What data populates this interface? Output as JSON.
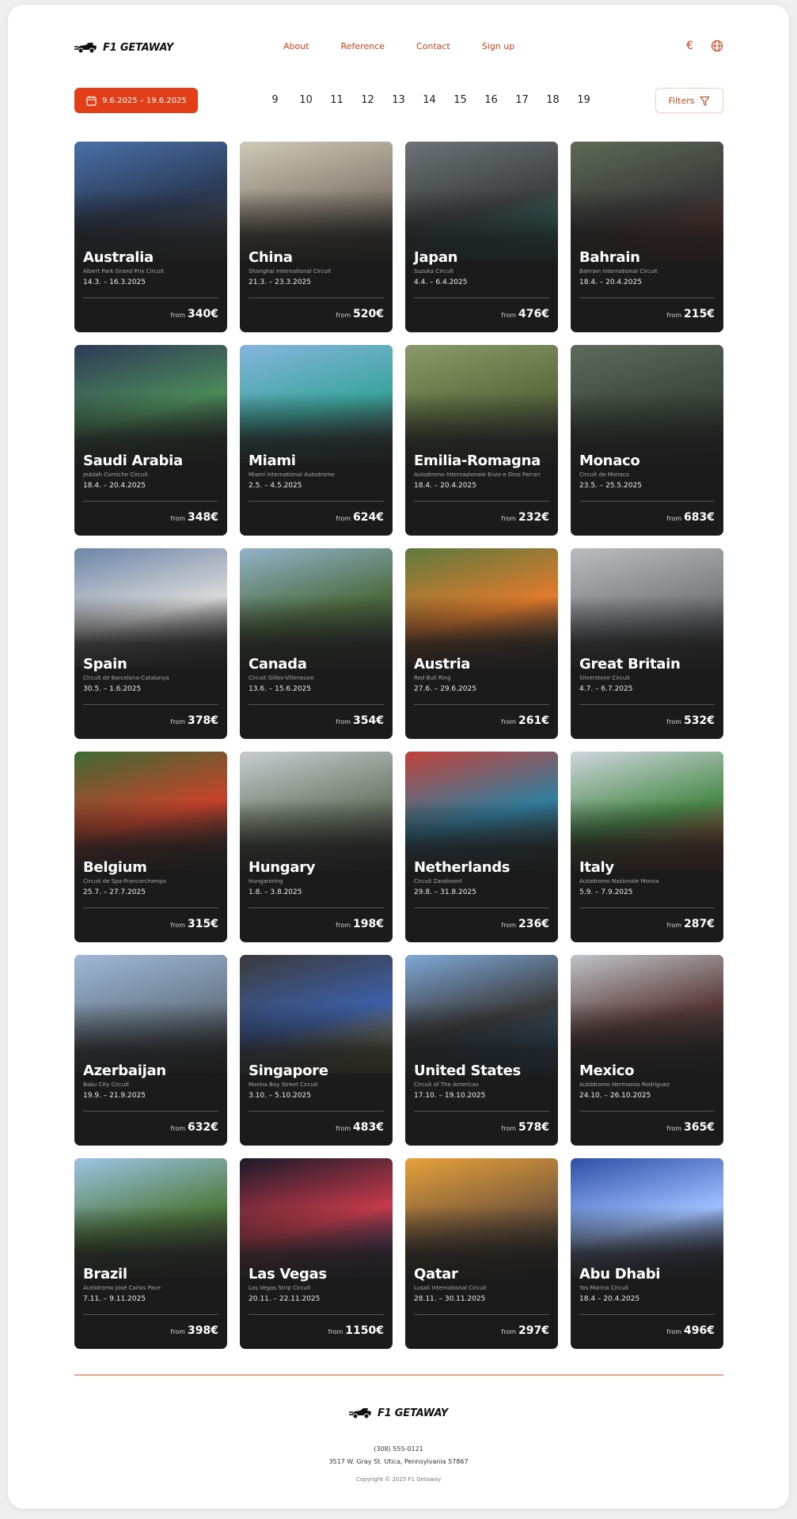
{
  "brand": {
    "name": "F1 GETAWAY",
    "accent_color": "#e23e17"
  },
  "nav": {
    "items": [
      "About",
      "Reference",
      "Contact",
      "Sign up"
    ]
  },
  "header_icons": {
    "currency": "euro-icon",
    "language": "globe-icon",
    "currency_symbol": "€"
  },
  "toolbar": {
    "date_range": "9.6.2025 – 19.6.2025",
    "days": [
      "9",
      "10",
      "11",
      "12",
      "13",
      "14",
      "15",
      "16",
      "17",
      "18",
      "19"
    ],
    "filters_label": "Filters"
  },
  "price_prefix": "from",
  "races": [
    {
      "country": "Australia",
      "circuit": "Albert Park Grand Prix Circuit",
      "dates": "14.3. – 16.3.2025",
      "price": "340€"
    },
    {
      "country": "China",
      "circuit": "Shanghai International Circuit",
      "dates": "21.3. – 23.3.2025",
      "price": "520€"
    },
    {
      "country": "Japan",
      "circuit": "Suzuka Circuit",
      "dates": "4.4. – 6.4.2025",
      "price": "476€"
    },
    {
      "country": "Bahrain",
      "circuit": "Bahrain International Circuit",
      "dates": "18.4. – 20.4.2025",
      "price": "215€"
    },
    {
      "country": "Saudi Arabia",
      "circuit": "Jeddah Corniche Circuit",
      "dates": "18.4. – 20.4.2025",
      "price": "348€"
    },
    {
      "country": "Miami",
      "circuit": "Miami International Autodrome",
      "dates": "2.5. – 4.5.2025",
      "price": "624€"
    },
    {
      "country": "Emilia-Romagna",
      "circuit": "Autodromo Internazionale Enzo e Dino Ferrari",
      "dates": "18.4. – 20.4.2025",
      "price": "232€"
    },
    {
      "country": "Monaco",
      "circuit": "Circuit de Monaco",
      "dates": "23.5. – 25.5.2025",
      "price": "683€"
    },
    {
      "country": "Spain",
      "circuit": "Circuit de Barcelona-Catalunya",
      "dates": "30.5. – 1.6.2025",
      "price": "378€"
    },
    {
      "country": "Canada",
      "circuit": "Circuit Gilles-Villeneuve",
      "dates": "13.6. – 15.6.2025",
      "price": "354€"
    },
    {
      "country": "Austria",
      "circuit": "Red Bull Ring",
      "dates": "27.6. – 29.6.2025",
      "price": "261€"
    },
    {
      "country": "Great Britain",
      "circuit": "Silverstone Circuit",
      "dates": "4.7. – 6.7.2025",
      "price": "532€"
    },
    {
      "country": "Belgium",
      "circuit": "Circuit de Spa-Francorchamps",
      "dates": "25.7. – 27.7.2025",
      "price": "315€"
    },
    {
      "country": "Hungary",
      "circuit": "Hungaroring",
      "dates": "1.8. – 3.8.2025",
      "price": "198€"
    },
    {
      "country": "Netherlands",
      "circuit": "Circuit Zandvoort",
      "dates": "29.8. – 31.8.2025",
      "price": "236€"
    },
    {
      "country": "Italy",
      "circuit": "Autodromo Nazionale Monza",
      "dates": "5.9. – 7.9.2025",
      "price": "287€"
    },
    {
      "country": "Azerbaijan",
      "circuit": "Baku City Circuit",
      "dates": "19.9. – 21.9.2025",
      "price": "632€"
    },
    {
      "country": "Singapore",
      "circuit": "Marina Bay Street Circuit",
      "dates": "3.10. – 5.10.2025",
      "price": "483€"
    },
    {
      "country": "United States",
      "circuit": "Circuit of The Americas",
      "dates": "17.10. – 19.10.2025",
      "price": "578€"
    },
    {
      "country": "Mexico",
      "circuit": "Autódromo Hermanos Rodríguez",
      "dates": "24.10. – 26.10.2025",
      "price": "365€"
    },
    {
      "country": "Brazil",
      "circuit": "Autódromo José Carlos Pace",
      "dates": "7.11. – 9.11.2025",
      "price": "398€"
    },
    {
      "country": "Las Vegas",
      "circuit": "Las Vegas Strip Circuit",
      "dates": "20.11. – 22.11.2025",
      "price": "1150€"
    },
    {
      "country": "Qatar",
      "circuit": "Lusail International Circuit",
      "dates": "28.11. – 30.11.2025",
      "price": "297€"
    },
    {
      "country": "Abu Dhabi",
      "circuit": "Yas Marina Circuit",
      "dates": "18.4 – 20.4.2025",
      "price": "496€"
    }
  ],
  "footer": {
    "phone": "(308) 555-0121",
    "address": "3517 W. Gray St. Utica, Pennsylvania 57867",
    "copyright": "Copyright © 2025 F1 Getaway"
  }
}
